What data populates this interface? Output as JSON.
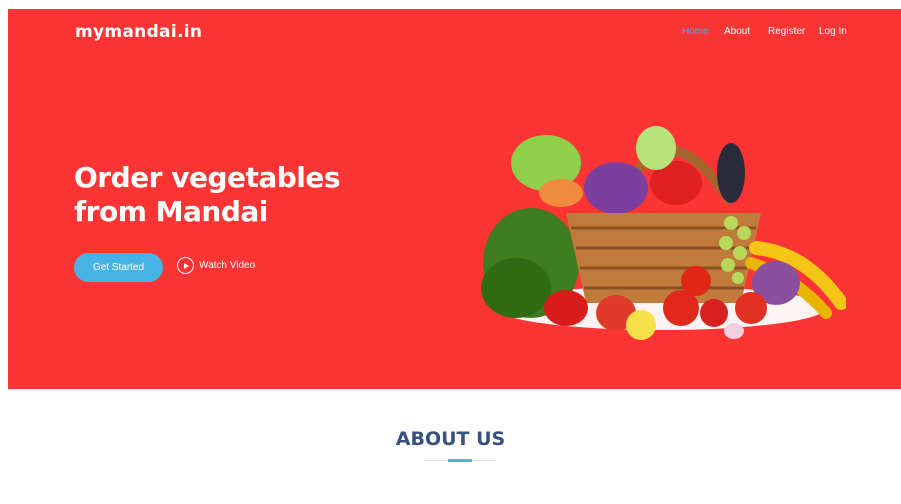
{
  "brand": {
    "name": "mymandai.in"
  },
  "nav": {
    "items": [
      {
        "label": "Home",
        "active": true
      },
      {
        "label": "About",
        "active": false
      },
      {
        "label": "Register",
        "active": false
      },
      {
        "label": "Log In",
        "active": false
      }
    ]
  },
  "hero": {
    "headline": "Order vegetables from Mandai",
    "cta_label": "Get Started",
    "video_label": "Watch Video",
    "image_icon": "vegetable-basket"
  },
  "about": {
    "title": "ABOUT US"
  },
  "colors": {
    "hero_bg": "#fd3434",
    "accent": "#47b2e4",
    "heading": "#37517e"
  }
}
